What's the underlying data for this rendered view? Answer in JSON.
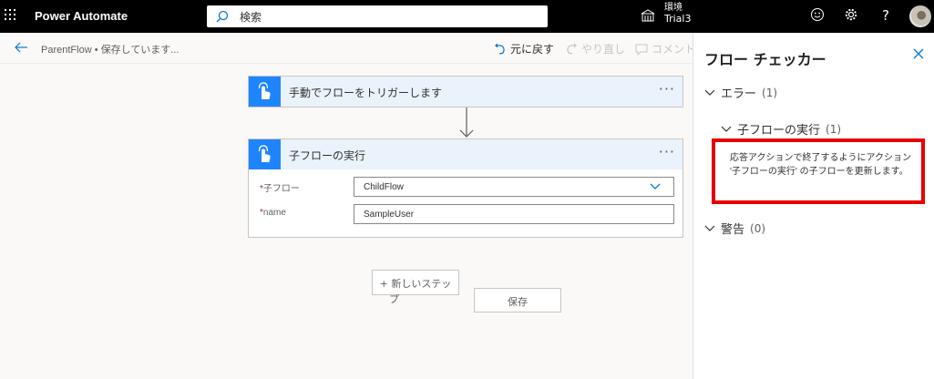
{
  "topbar": {
    "app_name": "Power Automate",
    "search_placeholder": "検索",
    "env_label": "環境",
    "env_value": "Trial3"
  },
  "cmdbar": {
    "breadcrumb": "ParentFlow • 保存しています...",
    "undo": "元に戻す",
    "redo": "やり直し",
    "comment": "コメント"
  },
  "flow": {
    "trigger_title": "手動でフローをトリガーします",
    "action_title": "子フローの実行",
    "fields": [
      {
        "label": "子フロー",
        "value": "ChildFlow"
      },
      {
        "label": "name",
        "value": "SampleUser"
      }
    ],
    "new_step": "+ 新しいステッ",
    "new_step_wrap": "プ",
    "save": "保存"
  },
  "checker": {
    "title": "フロー チェッカー",
    "errors_label": "エラー",
    "errors_count": "(1)",
    "sub_label": "子フローの実行",
    "sub_count": "(1)",
    "message": "応答アクションで終了するようにアクション '子フローの実行' の子フローを更新します。",
    "warnings_label": "警告",
    "warnings_count": "(0)"
  },
  "colors": {
    "accent": "#1f85ff",
    "card_header": "#eaf3fc",
    "highlight": "#e60000",
    "topbar": "#000000"
  }
}
